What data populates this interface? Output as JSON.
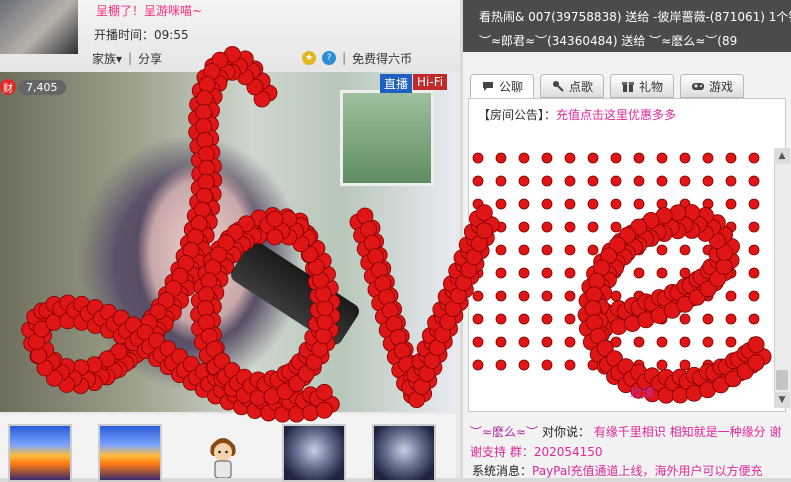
{
  "host": {
    "title": "呈棚了！呈游咪喵~",
    "start_time": "开播时间：09:55",
    "nav": {
      "family": "家族",
      "share": "分享",
      "free_coins": "免费得六币"
    },
    "wealth_icon": "财",
    "wealth_count": "7,405",
    "badges": {
      "live": "直播",
      "hifi": "Hi-Fi"
    }
  },
  "gift_ticker": {
    "line1": "看热闹& 007(39758838) 送给 -彼岸蔷薇-(871061) 1个钻",
    "line2": "︶≈郎君≈︶(34360484) 送给 ︶≈麽么≈︶(89"
  },
  "tabs": [
    {
      "label": "公聊",
      "icon": "chat-bubble-icon"
    },
    {
      "label": "点歌",
      "icon": "microphone-icon"
    },
    {
      "label": "礼物",
      "icon": "gift-box-icon"
    },
    {
      "label": "游戏",
      "icon": "gamepad-icon"
    }
  ],
  "notice": {
    "label": "【房间公告】：",
    "text": "充值点击这里优惠多多"
  },
  "rose_text": "玫瑰",
  "overlay_text": "Love",
  "public_msg": {
    "sender": "︶≈麽么≈︶",
    "verb": "对你说：",
    "content": "有缘千里相识 相知就是一种缘分 谢谢支持 群：202054150"
  },
  "system_msg": {
    "label": "系统消息：",
    "text": "PayPal充值通道上线，海外用户可以方便充"
  },
  "colors": {
    "rose": "#e01616",
    "accent_pink": "#e0289a",
    "ticker_bg": "#4b4b4b",
    "live_blue": "#1f5fbf",
    "hifi_red": "#c02a2a"
  }
}
